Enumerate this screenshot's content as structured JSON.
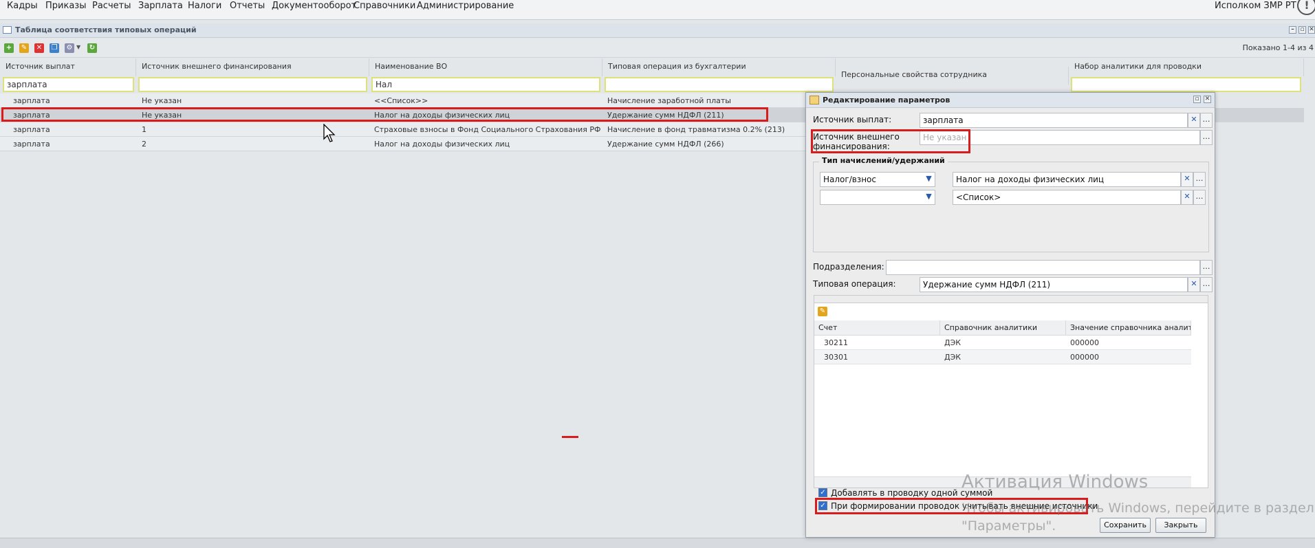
{
  "menu": {
    "items": [
      "Кадры",
      "Приказы",
      "Расчеты",
      "Зарплата",
      "Налоги",
      "Отчеты",
      "Документооборот",
      "Справочники",
      "Администрирование"
    ],
    "user": "Исполком ЗМР РТ",
    "info_icon": "!"
  },
  "window": {
    "title": "Таблица соответствия типовых операций",
    "shown_count": "Показано 1-4 из 4"
  },
  "grid": {
    "columns": [
      "Источник выплат",
      "Источник внешнего финансирования",
      "Наименование ВО",
      "Типовая операция из бухгалтерии",
      "Персональные свойства сотрудника",
      "Набор аналитики для проводки"
    ],
    "filters": [
      "зарплата",
      "",
      "Нал",
      "",
      "",
      ""
    ],
    "rows": [
      [
        "зарплата",
        "Не указан",
        "<<Список>>",
        "Начисление заработной платы"
      ],
      [
        "зарплата",
        "Не указан",
        "Налог на доходы физических лиц",
        "Удержание сумм НДФЛ (211)"
      ],
      [
        "зарплата",
        "1",
        "Страховые взносы в Фонд Социального Страхования РФ в час...",
        "Начисление в фонд травматизма 0.2% (213)"
      ],
      [
        "зарплата",
        "2",
        "Налог на доходы физических лиц",
        "Удержание сумм НДФЛ (266)"
      ]
    ]
  },
  "dialog": {
    "title": "Редактирование параметров",
    "source_label": "Источник выплат:",
    "source_value": "зарплата",
    "ext_source_label1": "Источник внешнего",
    "ext_source_label2": "финансирования:",
    "ext_source_placeholder": "Не указан",
    "fieldset_legend": "Тип начислений/удержаний",
    "type1_select": "Налог/взнос",
    "type1_value": "Налог на доходы физических лиц",
    "type2_select": "",
    "type2_value": "<Список>",
    "dept_label": "Подразделения:",
    "dept_value": "",
    "op_label": "Типовая операция:",
    "op_value": "Удержание сумм НДФЛ (211)",
    "inner_grid": {
      "columns": [
        "Счет",
        "Справочник аналитики",
        "Значение справочника аналити..."
      ],
      "rows": [
        [
          "30211",
          "ДЭК",
          "000000"
        ],
        [
          "30301",
          "ДЭК",
          "000000"
        ]
      ]
    },
    "check1_label": "Добавлять в проводку одной суммой",
    "check2_label": "При формировании проводок учитывать внешние источники",
    "save_label": "Сохранить",
    "close_label": "Закрыть"
  },
  "watermark": {
    "line1": "Активация Windows",
    "line2": "Чтобы активировать Windows, перейдите в раздел \"Параметры\"."
  },
  "colors": {
    "highlight": "#d81b1b",
    "filter_border": "#dde27a"
  }
}
